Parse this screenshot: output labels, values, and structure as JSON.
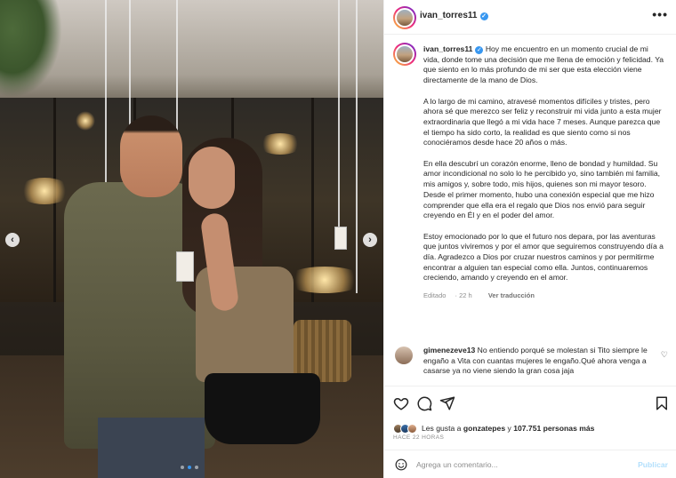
{
  "post": {
    "username": "ivan_torres11",
    "verified": true,
    "more_icon": "more-horizontal-icon"
  },
  "photo": {
    "prev_arrow": "‹",
    "next_arrow": "›",
    "carousel_count": 3,
    "carousel_active": 2
  },
  "caption": {
    "username": "ivan_torres11",
    "paragraphs": [
      "Hoy me encuentro en un momento crucial de mi vida, donde tome una decisión que me llena de emoción y felicidad. Ya que siento en lo más profundo de mi ser que esta elección viene directamente de la mano de Dios.",
      "A lo largo de mi camino, atravesé momentos difíciles y tristes, pero ahora sé que merezco ser feliz y reconstruir mi vida junto a esta mujer extraordinaria que llegó a mi vida hace 7 meses. Aunque parezca que el tiempo ha sido corto, la realidad es que siento como si nos conociéramos desde hace 20 años o más.",
      "En ella descubrí un corazón enorme, lleno de bondad y humildad. Su amor incondicional no solo lo he percibido yo, sino también mi familia, mis amigos y, sobre todo, mis hijos, quienes son mi mayor tesoro. Desde el primer momento, hubo una conexión especial que me hizo comprender que ella era el regalo que Dios nos envió para seguir creyendo en Él y en el poder del amor.",
      "Estoy emocionado por lo que el futuro nos depara, por las aventuras que juntos viviremos y por el amor que seguiremos construyendo día a día. Agradezco a Dios por cruzar nuestros caminos y por permitirme encontrar a alguien tan especial como ella. Juntos, continuaremos creciendo, amando y creyendo en el amor."
    ],
    "edited_label": "Editado",
    "edited_time": "22 h",
    "translate_label": "Ver traducción"
  },
  "comment": {
    "username": "gimenezeve13",
    "text": "No entiendo porqué se molestan si Tito siempre le engaño a Vita con cuantas mujeres le engaño.Qué ahora venga a casarse ya no viene siendo la gran cosa jaja"
  },
  "actions": {
    "like_icon": "heart-icon",
    "comment_icon": "comment-icon",
    "share_icon": "share-icon",
    "save_icon": "bookmark-icon"
  },
  "likes": {
    "prefix": "Les gusta a ",
    "user": "gonzatepes",
    "middle": " y ",
    "count": "107.751 personas más"
  },
  "time_ago": "HACE 22 HORAS",
  "add_comment": {
    "placeholder": "Agrega un comentario...",
    "publish_label": "Publicar",
    "emoji_icon": "emoji-icon"
  }
}
